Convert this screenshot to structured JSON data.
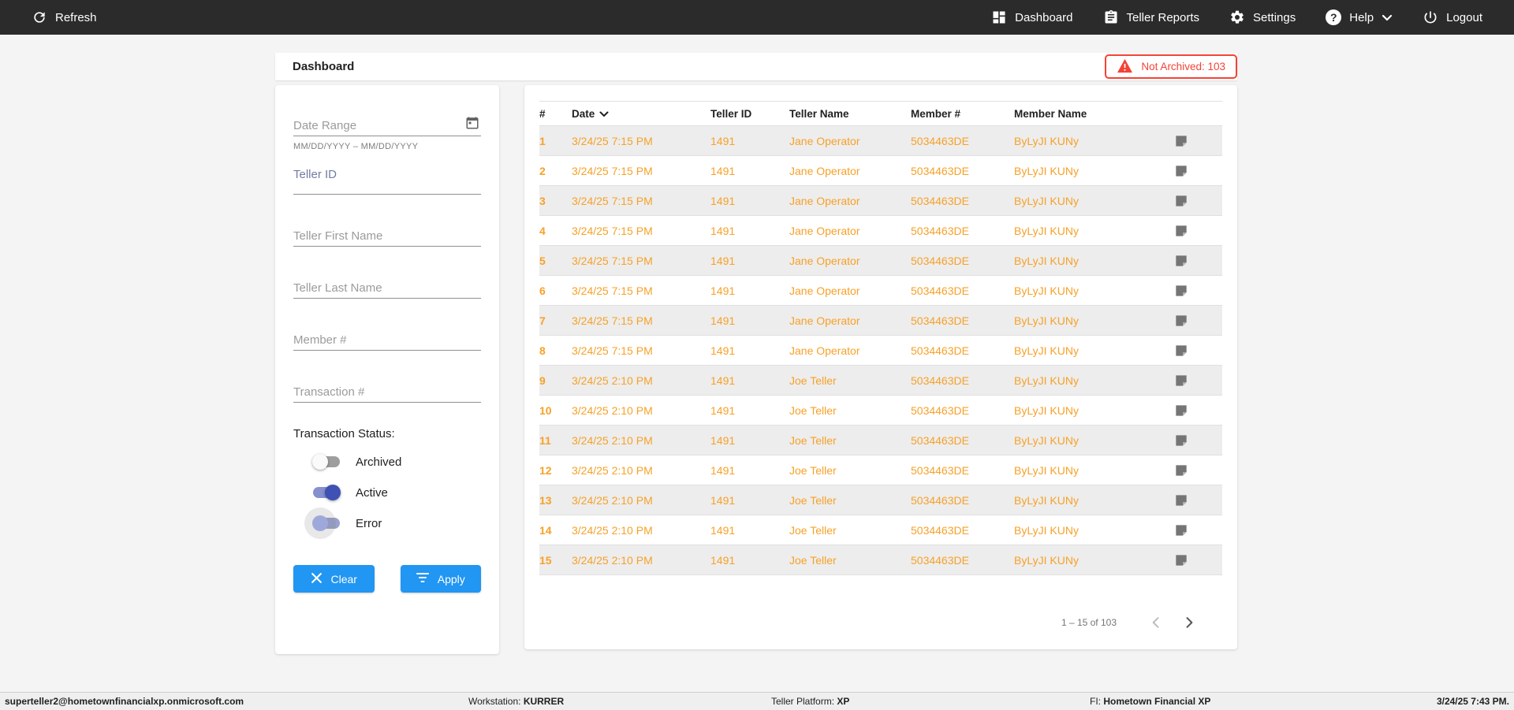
{
  "topbar": {
    "refresh_label": "Refresh",
    "items": [
      {
        "label": "Dashboard"
      },
      {
        "label": "Teller Reports"
      },
      {
        "label": "Settings"
      },
      {
        "label": "Help"
      },
      {
        "label": "Logout"
      }
    ]
  },
  "header": {
    "title": "Dashboard",
    "badge_label": "Not Archived: 103"
  },
  "filters": {
    "date_range": {
      "placeholder": "Date Range",
      "helper": "MM/DD/YYYY – MM/DD/YYYY",
      "value": ""
    },
    "teller_id": {
      "placeholder": "Teller ID",
      "value": ""
    },
    "teller_first_name": {
      "placeholder": "Teller First Name",
      "value": ""
    },
    "teller_last_name": {
      "placeholder": "Teller Last Name",
      "value": ""
    },
    "member_number": {
      "placeholder": "Member #",
      "value": ""
    },
    "transaction_number": {
      "placeholder": "Transaction #",
      "value": ""
    },
    "status": {
      "label": "Transaction Status:",
      "toggles": [
        {
          "label": "Archived",
          "state": "off"
        },
        {
          "label": "Active",
          "state": "on"
        },
        {
          "label": "Error",
          "state": "off-focus"
        }
      ]
    },
    "clear_label": "Clear",
    "apply_label": "Apply"
  },
  "table": {
    "columns": [
      "#",
      "Date",
      "Teller ID",
      "Teller Name",
      "Member #",
      "Member Name"
    ],
    "sort_column": "Date",
    "sort_direction": "desc",
    "rows": [
      {
        "num": "1",
        "date": "3/24/25 7:15 PM",
        "teller_id": "1491",
        "teller_name": "Jane Operator",
        "member_number": "5034463DE",
        "member_name": "ByLyJI KUNy"
      },
      {
        "num": "2",
        "date": "3/24/25 7:15 PM",
        "teller_id": "1491",
        "teller_name": "Jane Operator",
        "member_number": "5034463DE",
        "member_name": "ByLyJI KUNy"
      },
      {
        "num": "3",
        "date": "3/24/25 7:15 PM",
        "teller_id": "1491",
        "teller_name": "Jane Operator",
        "member_number": "5034463DE",
        "member_name": "ByLyJI KUNy"
      },
      {
        "num": "4",
        "date": "3/24/25 7:15 PM",
        "teller_id": "1491",
        "teller_name": "Jane Operator",
        "member_number": "5034463DE",
        "member_name": "ByLyJI KUNy"
      },
      {
        "num": "5",
        "date": "3/24/25 7:15 PM",
        "teller_id": "1491",
        "teller_name": "Jane Operator",
        "member_number": "5034463DE",
        "member_name": "ByLyJI KUNy"
      },
      {
        "num": "6",
        "date": "3/24/25 7:15 PM",
        "teller_id": "1491",
        "teller_name": "Jane Operator",
        "member_number": "5034463DE",
        "member_name": "ByLyJI KUNy"
      },
      {
        "num": "7",
        "date": "3/24/25 7:15 PM",
        "teller_id": "1491",
        "teller_name": "Jane Operator",
        "member_number": "5034463DE",
        "member_name": "ByLyJI KUNy"
      },
      {
        "num": "8",
        "date": "3/24/25 7:15 PM",
        "teller_id": "1491",
        "teller_name": "Jane Operator",
        "member_number": "5034463DE",
        "member_name": "ByLyJI KUNy"
      },
      {
        "num": "9",
        "date": "3/24/25 2:10 PM",
        "teller_id": "1491",
        "teller_name": "Joe Teller",
        "member_number": "5034463DE",
        "member_name": "ByLyJI KUNy"
      },
      {
        "num": "10",
        "date": "3/24/25 2:10 PM",
        "teller_id": "1491",
        "teller_name": "Joe Teller",
        "member_number": "5034463DE",
        "member_name": "ByLyJI KUNy"
      },
      {
        "num": "11",
        "date": "3/24/25 2:10 PM",
        "teller_id": "1491",
        "teller_name": "Joe Teller",
        "member_number": "5034463DE",
        "member_name": "ByLyJI KUNy"
      },
      {
        "num": "12",
        "date": "3/24/25 2:10 PM",
        "teller_id": "1491",
        "teller_name": "Joe Teller",
        "member_number": "5034463DE",
        "member_name": "ByLyJI KUNy"
      },
      {
        "num": "13",
        "date": "3/24/25 2:10 PM",
        "teller_id": "1491",
        "teller_name": "Joe Teller",
        "member_number": "5034463DE",
        "member_name": "ByLyJI KUNy"
      },
      {
        "num": "14",
        "date": "3/24/25 2:10 PM",
        "teller_id": "1491",
        "teller_name": "Joe Teller",
        "member_number": "5034463DE",
        "member_name": "ByLyJI KUNy"
      },
      {
        "num": "15",
        "date": "3/24/25 2:10 PM",
        "teller_id": "1491",
        "teller_name": "Joe Teller",
        "member_number": "5034463DE",
        "member_name": "ByLyJI KUNy"
      }
    ]
  },
  "pagination": {
    "range_label": "1 – 15 of 103"
  },
  "statusbar": {
    "user": "superteller2@hometownfinancialxp.onmicrosoft.com",
    "workstation_label": "Workstation: ",
    "workstation": "KURRER",
    "platform_label": "Teller Platform: ",
    "platform": "XP",
    "fi_label": "FI: ",
    "fi": "Hometown Financial XP",
    "datetime": "3/24/25 7:43 PM."
  },
  "colors": {
    "accent_orange": "#f7a128",
    "button_blue": "#2196f3",
    "alert_red": "#f44336",
    "toggle_indigo": "#3f51b5",
    "topnav_bg": "#2b2b2b"
  }
}
